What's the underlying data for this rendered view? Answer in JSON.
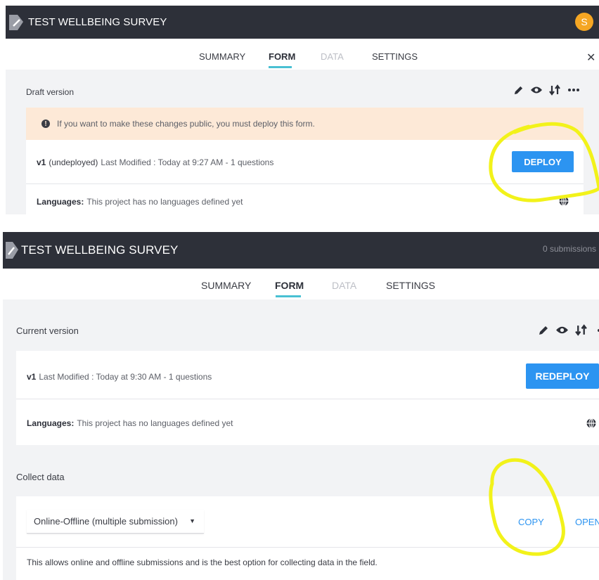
{
  "panel1": {
    "title": "TEST WELLBEING SURVEY",
    "avatar_initial": "S",
    "tabs": [
      {
        "label": "SUMMARY",
        "state": "normal"
      },
      {
        "label": "FORM",
        "state": "active"
      },
      {
        "label": "DATA",
        "state": "disabled"
      },
      {
        "label": "SETTINGS",
        "state": "normal"
      }
    ],
    "close_label": "✕",
    "version_label": "Draft version",
    "warning_text": "If you want to make these changes public, you must deploy this form.",
    "version_row": {
      "name": "v1",
      "status": "(undeployed)",
      "info": "Last Modified : Today at 9:27 AM - 1 questions"
    },
    "deploy_label": "DEPLOY",
    "languages_label": "Languages:",
    "languages_text": "This project has no languages defined yet"
  },
  "panel2": {
    "title": "TEST WELLBEING SURVEY",
    "submissions": "0 submissions",
    "tabs": [
      {
        "label": "SUMMARY",
        "state": "normal"
      },
      {
        "label": "FORM",
        "state": "active"
      },
      {
        "label": "DATA",
        "state": "disabled"
      },
      {
        "label": "SETTINGS",
        "state": "normal"
      }
    ],
    "version_label": "Current version",
    "version_row": {
      "name": "v1",
      "info": "Last Modified : Today at 9:30 AM - 1 questions"
    },
    "redeploy_label": "REDEPLOY",
    "languages_label": "Languages:",
    "languages_text": "This project has no languages defined yet",
    "collect_label": "Collect data",
    "collect_select": "Online-Offline (multiple submission)",
    "copy_label": "COPY",
    "open_label": "OPEN",
    "collect_description": "This allows online and offline submissions and is the best option for collecting data in the field."
  },
  "colors": {
    "header_bg": "#2d3039",
    "accent_blue": "#2c94f1",
    "tab_underline": "#49c0d3",
    "warning_bg": "#fde9d7",
    "avatar_bg": "#f5a623",
    "highlight_yellow": "#f2f21a"
  },
  "icons": [
    "logo-icon",
    "pencil-icon",
    "eye-icon",
    "refresh-icon",
    "more-icon",
    "globe-icon",
    "caret-down-icon",
    "warning-icon"
  ]
}
